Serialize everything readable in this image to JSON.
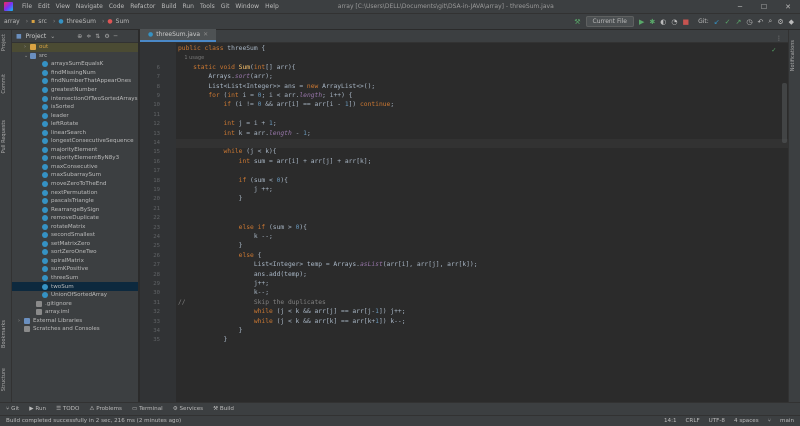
{
  "menu": [
    "File",
    "Edit",
    "View",
    "Navigate",
    "Code",
    "Refactor",
    "Build",
    "Run",
    "Tools",
    "Git",
    "Window",
    "Help"
  ],
  "window_title": "array [C:\\Users\\DELL\\Documents\\git\\DSA-in-JAVA\\array] - threeSum.java",
  "breadcrumb": {
    "root": "array",
    "src": "src",
    "file": "threeSum",
    "method": "Sum"
  },
  "run_config": "Current File",
  "git_label": "Git:",
  "project_panel": {
    "title": "Project"
  },
  "tree": [
    {
      "label": "out",
      "indent": 2,
      "arrow": "›",
      "icon": "dir",
      "style": "hl"
    },
    {
      "label": "src",
      "indent": 2,
      "arrow": "⌄",
      "icon": "dirb",
      "style": ""
    },
    {
      "label": "arraysSumEqualsK",
      "indent": 4,
      "icon": "cls"
    },
    {
      "label": "findMissingNum",
      "indent": 4,
      "icon": "cls"
    },
    {
      "label": "findNumberThatAppearOnes",
      "indent": 4,
      "icon": "cls"
    },
    {
      "label": "greatestNumber",
      "indent": 4,
      "icon": "cls"
    },
    {
      "label": "intersectionOfTwoSortedArrays",
      "indent": 4,
      "icon": "cls"
    },
    {
      "label": "isSorted",
      "indent": 4,
      "icon": "cls"
    },
    {
      "label": "leader",
      "indent": 4,
      "icon": "cls"
    },
    {
      "label": "leftRotate",
      "indent": 4,
      "icon": "cls"
    },
    {
      "label": "linearSearch",
      "indent": 4,
      "icon": "cls"
    },
    {
      "label": "longestConsecutiveSequence",
      "indent": 4,
      "icon": "cls"
    },
    {
      "label": "majorityElement",
      "indent": 4,
      "icon": "cls"
    },
    {
      "label": "majorityElementByN8y3",
      "indent": 4,
      "icon": "cls"
    },
    {
      "label": "maxConsecutive",
      "indent": 4,
      "icon": "cls"
    },
    {
      "label": "maxSubarraySum",
      "indent": 4,
      "icon": "cls"
    },
    {
      "label": "moveZeroToTheEnd",
      "indent": 4,
      "icon": "cls"
    },
    {
      "label": "nextPermutation",
      "indent": 4,
      "icon": "cls"
    },
    {
      "label": "pascalsTriangle",
      "indent": 4,
      "icon": "cls"
    },
    {
      "label": "RearrangeBySign",
      "indent": 4,
      "icon": "cls"
    },
    {
      "label": "removeDuplicate",
      "indent": 4,
      "icon": "cls"
    },
    {
      "label": "rotateMatrix",
      "indent": 4,
      "icon": "cls"
    },
    {
      "label": "secondSmallest",
      "indent": 4,
      "icon": "cls"
    },
    {
      "label": "setMatrixZero",
      "indent": 4,
      "icon": "cls"
    },
    {
      "label": "sortZeroOneTwo",
      "indent": 4,
      "icon": "cls"
    },
    {
      "label": "spiralMatrix",
      "indent": 4,
      "icon": "cls"
    },
    {
      "label": "sumKPositive",
      "indent": 4,
      "icon": "cls"
    },
    {
      "label": "threeSum",
      "indent": 4,
      "icon": "cls"
    },
    {
      "label": "twoSum",
      "indent": 4,
      "icon": "cls",
      "style": "sel"
    },
    {
      "label": "UnionOfSortedArray",
      "indent": 4,
      "icon": "cls"
    },
    {
      "label": ".gitignore",
      "indent": 3,
      "icon": "file"
    },
    {
      "label": "array.iml",
      "indent": 3,
      "icon": "file"
    },
    {
      "label": "External Libraries",
      "indent": 1,
      "arrow": "›",
      "icon": "dirb"
    },
    {
      "label": "Scratches and Consoles",
      "indent": 1,
      "arrow": "",
      "icon": "file"
    }
  ],
  "editor_tab": "threeSum.java",
  "code": [
    {
      "n": "",
      "h": "<span class='kw'>public class </span>threeSum {"
    },
    {
      "n": "",
      "h": "<span class='gr'>    1 usage</span>"
    },
    {
      "n": "6",
      "h": "    <span class='kw'>static void </span><span class='fn'>Sum</span>(<span class='kw'>int</span>[] arr){"
    },
    {
      "n": "7",
      "h": "        Arrays.<span class='it'>sort</span>(arr);"
    },
    {
      "n": "8",
      "h": "        List&lt;List&lt;Integer&gt;&gt; ans = <span class='kw'>new </span>ArrayList&lt;&gt;();"
    },
    {
      "n": "9",
      "h": "        <span class='kw'>for </span>(<span class='kw'>int </span>i = <span class='nm'>0</span>; i &lt; arr.<span class='it'>length</span>; i++) {"
    },
    {
      "n": "10",
      "h": "            <span class='kw'>if </span>(i != <span class='nm'>0 </span>&amp;&amp; arr[i] == arr[i - <span class='nm'>1</span>]) <span class='kw'>continue</span>;"
    },
    {
      "n": "11",
      "h": ""
    },
    {
      "n": "12",
      "h": "            <span class='kw'>int </span>j = i + <span class='nm'>1</span>;"
    },
    {
      "n": "13",
      "h": "            <span class='kw'>int </span>k = arr.<span class='it'>length </span>- <span class='nm'>1</span>;"
    },
    {
      "n": "14",
      "h": "",
      "cur": true
    },
    {
      "n": "15",
      "h": "            <span class='kw'>while </span>(j &lt; k){"
    },
    {
      "n": "16",
      "h": "                <span class='kw'>int </span>sum = arr[i] + arr[j] + arr[k];"
    },
    {
      "n": "17",
      "h": ""
    },
    {
      "n": "18",
      "h": "                <span class='kw'>if </span>(sum &lt; <span class='nm'>0</span>){"
    },
    {
      "n": "19",
      "h": "                    j ++;"
    },
    {
      "n": "20",
      "h": "                }"
    },
    {
      "n": "21",
      "h": ""
    },
    {
      "n": "22",
      "h": ""
    },
    {
      "n": "23",
      "h": "                <span class='kw'>else if </span>(sum &gt; <span class='nm'>0</span>){"
    },
    {
      "n": "24",
      "h": "                    k --;"
    },
    {
      "n": "25",
      "h": "                }"
    },
    {
      "n": "26",
      "h": "                <span class='kw'>else </span>{"
    },
    {
      "n": "27",
      "h": "                    List&lt;Integer&gt; temp = Arrays.<span class='it'>asList</span>(arr[i], arr[j], arr[k]);"
    },
    {
      "n": "28",
      "h": "                    ans.add(temp);"
    },
    {
      "n": "29",
      "h": "                    j++;"
    },
    {
      "n": "30",
      "h": "                    k--;"
    },
    {
      "n": "31",
      "h": "<span class='cm'>//                  Skip the duplicates</span>"
    },
    {
      "n": "32",
      "h": "                    <span class='kw'>while </span>(j &lt; k &amp;&amp; arr[j] == arr[j-<span class='nm'>1</span>]) j++;"
    },
    {
      "n": "33",
      "h": "                    <span class='kw'>while </span>(j &lt; k &amp;&amp; arr[k] == arr[k+<span class='nm'>1</span>]) k--;"
    },
    {
      "n": "34",
      "h": "                }"
    },
    {
      "n": "35",
      "h": "            }"
    }
  ],
  "left_tabs": [
    "Project",
    "Commit",
    "Pull Requests",
    "Bookmarks",
    "Structure"
  ],
  "right_tabs": [
    "Notifications"
  ],
  "bottom_tools": [
    "Git",
    "Run",
    "TODO",
    "Problems",
    "Terminal",
    "Services",
    "Build"
  ],
  "status_message": "Build completed successfully in 2 sec, 216 ms (2 minutes ago)",
  "status_right": [
    "14:1",
    "CRLF",
    "UTF-8",
    "4 spaces",
    "main"
  ]
}
